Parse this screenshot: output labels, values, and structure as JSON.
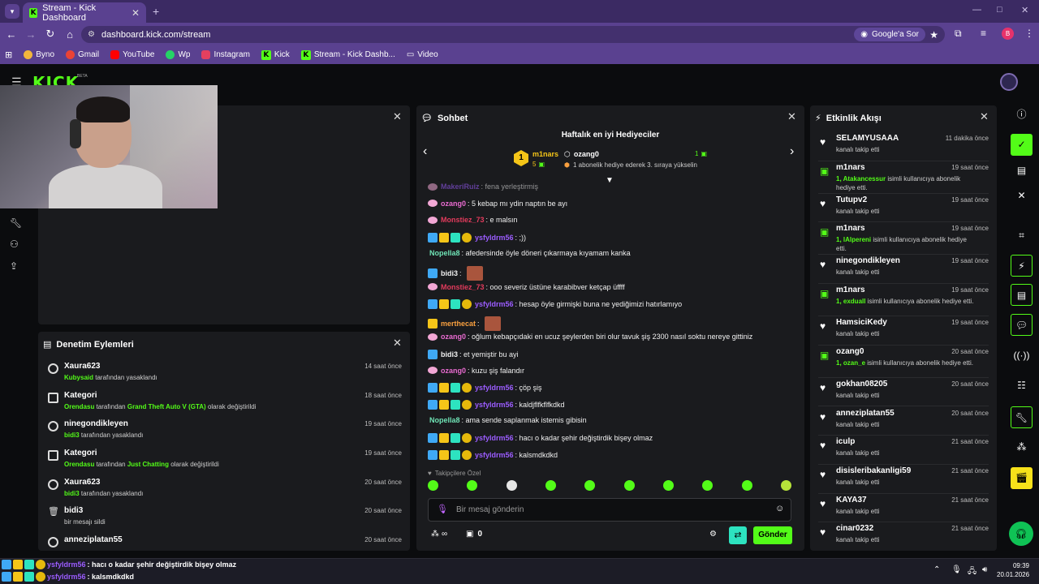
{
  "browser": {
    "tab_title": "Stream - Kick Dashboard",
    "url": "dashboard.kick.com/stream",
    "google_button": "Google'a Sor",
    "bookmarks": [
      "Byno",
      "Gmail",
      "YouTube",
      "Wp",
      "Instagram",
      "Kick",
      "Stream - Kick Dashb...",
      "Video"
    ],
    "bookmark_colors": [
      "#f2b63c",
      "#ea4335",
      "#ff0000",
      "#25d366",
      "#e4405f",
      "#53fc18",
      "#53fc18",
      "#f5c518"
    ]
  },
  "app": {
    "logo": "KICK",
    "beta": "BETA",
    "accent": "#53fc18"
  },
  "moderation": {
    "title": "Denetim Eylemleri",
    "items": [
      {
        "name": "Xaura623",
        "who": "Kubysaid",
        "desc": "tarafından yasaklandı",
        "time": "14 saat önce"
      },
      {
        "name": "Kategori",
        "who": "Orendasu",
        "desc": "tarafından",
        "target": "Grand Theft Auto V (GTA)",
        "desc2": "olarak değiştirildi",
        "time": "18 saat önce"
      },
      {
        "name": "ninegondikleyen",
        "who": "bidi3",
        "desc": "tarafından yasaklandı",
        "time": "19 saat önce"
      },
      {
        "name": "Kategori",
        "who": "Orendasu",
        "desc": "tarafından",
        "target": "Just Chatting",
        "desc2": "olarak değiştirildi",
        "time": "19 saat önce"
      },
      {
        "name": "Xaura623",
        "who": "bidi3",
        "desc": "tarafından yasaklandı",
        "time": "20 saat önce"
      },
      {
        "name": "bidi3",
        "who": "",
        "desc": "bir mesajı sildi",
        "time": "20 saat önce"
      },
      {
        "name": "anneziplatan55",
        "who": "",
        "desc": "",
        "time": "20 saat önce"
      }
    ]
  },
  "chat": {
    "title": "Sohbet",
    "gifters_title": "Haftalık en iyi Hediyeciler",
    "top_gifter": {
      "rank": "1",
      "name": "m1nars",
      "count": "5"
    },
    "second_gifter": {
      "name": "ozang0",
      "count": "1",
      "note": "1 abonelik hediye ederek 3. sıraya yükselin"
    },
    "messages": [
      {
        "user": "MakeriRuiz",
        "color": "u-pur",
        "text": ": fena yerleştirmiş",
        "badges": "pink"
      },
      {
        "user": "ozang0",
        "color": "u-pink",
        "text": ": 5 kebap mı ydin naptın be ayı",
        "badges": "pink"
      },
      {
        "user": "Monstiez_73",
        "color": "u-red",
        "text": ": e malsın",
        "badges": "pink"
      },
      {
        "user": "ysfyldrm56",
        "color": "u-pur",
        "text": ": ;))",
        "badges": "full"
      },
      {
        "user": "Nopella8",
        "color": "u-mint",
        "text": ": afedersinde öyle döneri çıkarmaya kıyamam kanka",
        "badges": "none"
      },
      {
        "user": "bidi3",
        "color": "u-wht",
        "text": ":",
        "badges": "blue",
        "emote": true
      },
      {
        "user": "Monstiez_73",
        "color": "u-red",
        "text": ": ooo severiz üstüne karabibver ketçap üffff",
        "badges": "pink"
      },
      {
        "user": "ysfyldrm56",
        "color": "u-pur",
        "text": ": hesap öyle girmişki buna ne yediğimizi hatırlamıyo",
        "badges": "full"
      },
      {
        "user": "merthecat",
        "color": "u-org",
        "text": ":",
        "badges": "yel",
        "emote": true
      },
      {
        "user": "ozang0",
        "color": "u-pink",
        "text": ": oğlum kebapçıdaki en ucuz şeylerden biri olur tavuk şiş 2300 nasıl soktu nereye gittiniz",
        "badges": "pink"
      },
      {
        "user": "bidi3",
        "color": "u-wht",
        "text": ": et yemiştir bu ayi",
        "badges": "blue"
      },
      {
        "user": "ozang0",
        "color": "u-pink",
        "text": ": kuzu şiş falandır",
        "badges": "pink"
      },
      {
        "user": "ysfyldrm56",
        "color": "u-pur",
        "text": ": çöp şiş",
        "badges": "full"
      },
      {
        "user": "ysfyldrm56",
        "color": "u-pur",
        "text": ": kaldjflfkflfkdkd",
        "badges": "full"
      },
      {
        "user": "Nopella8",
        "color": "u-mint",
        "text": ": ama sende saplanmak istemis gibisin",
        "badges": "none"
      },
      {
        "user": "ysfyldrm56",
        "color": "u-pur",
        "text": ": hacı o kadar şehir değiştirdik bişey olmaz",
        "badges": "full"
      },
      {
        "user": "ysfyldrm56",
        "color": "u-pur",
        "text": ": kalsmdkdkd",
        "badges": "full"
      }
    ],
    "followers_only": "Takipçilere Özel",
    "input_placeholder": "Bir mesaj gönderin",
    "infinity": "∞",
    "points": "0",
    "send": "Gönder"
  },
  "activity": {
    "title": "Etkinlik Akışı",
    "items": [
      {
        "type": "follow",
        "name": "SELAMYUSAAA",
        "desc": "kanalı takip etti",
        "time": "11 dakika önce"
      },
      {
        "type": "gift",
        "name": "m1nars",
        "hl": "1, Atakancessur",
        "desc": "isimli kullanıcıya abonelik hediye etti.",
        "time": "19 saat önce"
      },
      {
        "type": "follow",
        "name": "Tutupv2",
        "desc": "kanalı takip etti",
        "time": "19 saat önce"
      },
      {
        "type": "gift",
        "name": "m1nars",
        "hl": "1, lAlpereni",
        "desc": "isimli kullanıcıya abonelik hediye etti.",
        "time": "19 saat önce"
      },
      {
        "type": "follow",
        "name": "ninegondikleyen",
        "desc": "kanalı takip etti",
        "time": "19 saat önce"
      },
      {
        "type": "gift",
        "name": "m1nars",
        "hl": "1, exduall",
        "desc": "isimli kullanıcıya abonelik hediye etti.",
        "time": "19 saat önce"
      },
      {
        "type": "follow",
        "name": "HamsiciKedy",
        "desc": "kanalı takip etti",
        "time": "19 saat önce"
      },
      {
        "type": "gift",
        "name": "ozang0",
        "hl": "1, ozan_e",
        "desc": "isimli kullanıcıya abonelik hediye etti.",
        "time": "20 saat önce"
      },
      {
        "type": "follow",
        "name": "gokhan08205",
        "desc": "kanalı takip etti",
        "time": "20 saat önce"
      },
      {
        "type": "follow",
        "name": "anneziplatan55",
        "desc": "kanalı takip etti",
        "time": "20 saat önce"
      },
      {
        "type": "follow",
        "name": "iculp",
        "desc": "kanalı takip etti",
        "time": "21 saat önce"
      },
      {
        "type": "follow",
        "name": "disisleribakanligi59",
        "desc": "kanalı takip etti",
        "time": "21 saat önce"
      },
      {
        "type": "follow",
        "name": "KAYA37",
        "desc": "kanalı takip etti",
        "time": "21 saat önce"
      },
      {
        "type": "follow",
        "name": "cinar0232",
        "desc": "kanalı takip etti",
        "time": "21 saat önce"
      }
    ]
  },
  "overlay": {
    "line1_user": "ysfyldrm56",
    "line1_text": ": hacı o kadar şehir değiştirdik bişey olmaz",
    "line2_user": "ysfyldrm56",
    "line2_text": ": kalsmdkdkd"
  },
  "taskbar": {
    "time": "09:39",
    "date": "20.01.2026"
  }
}
